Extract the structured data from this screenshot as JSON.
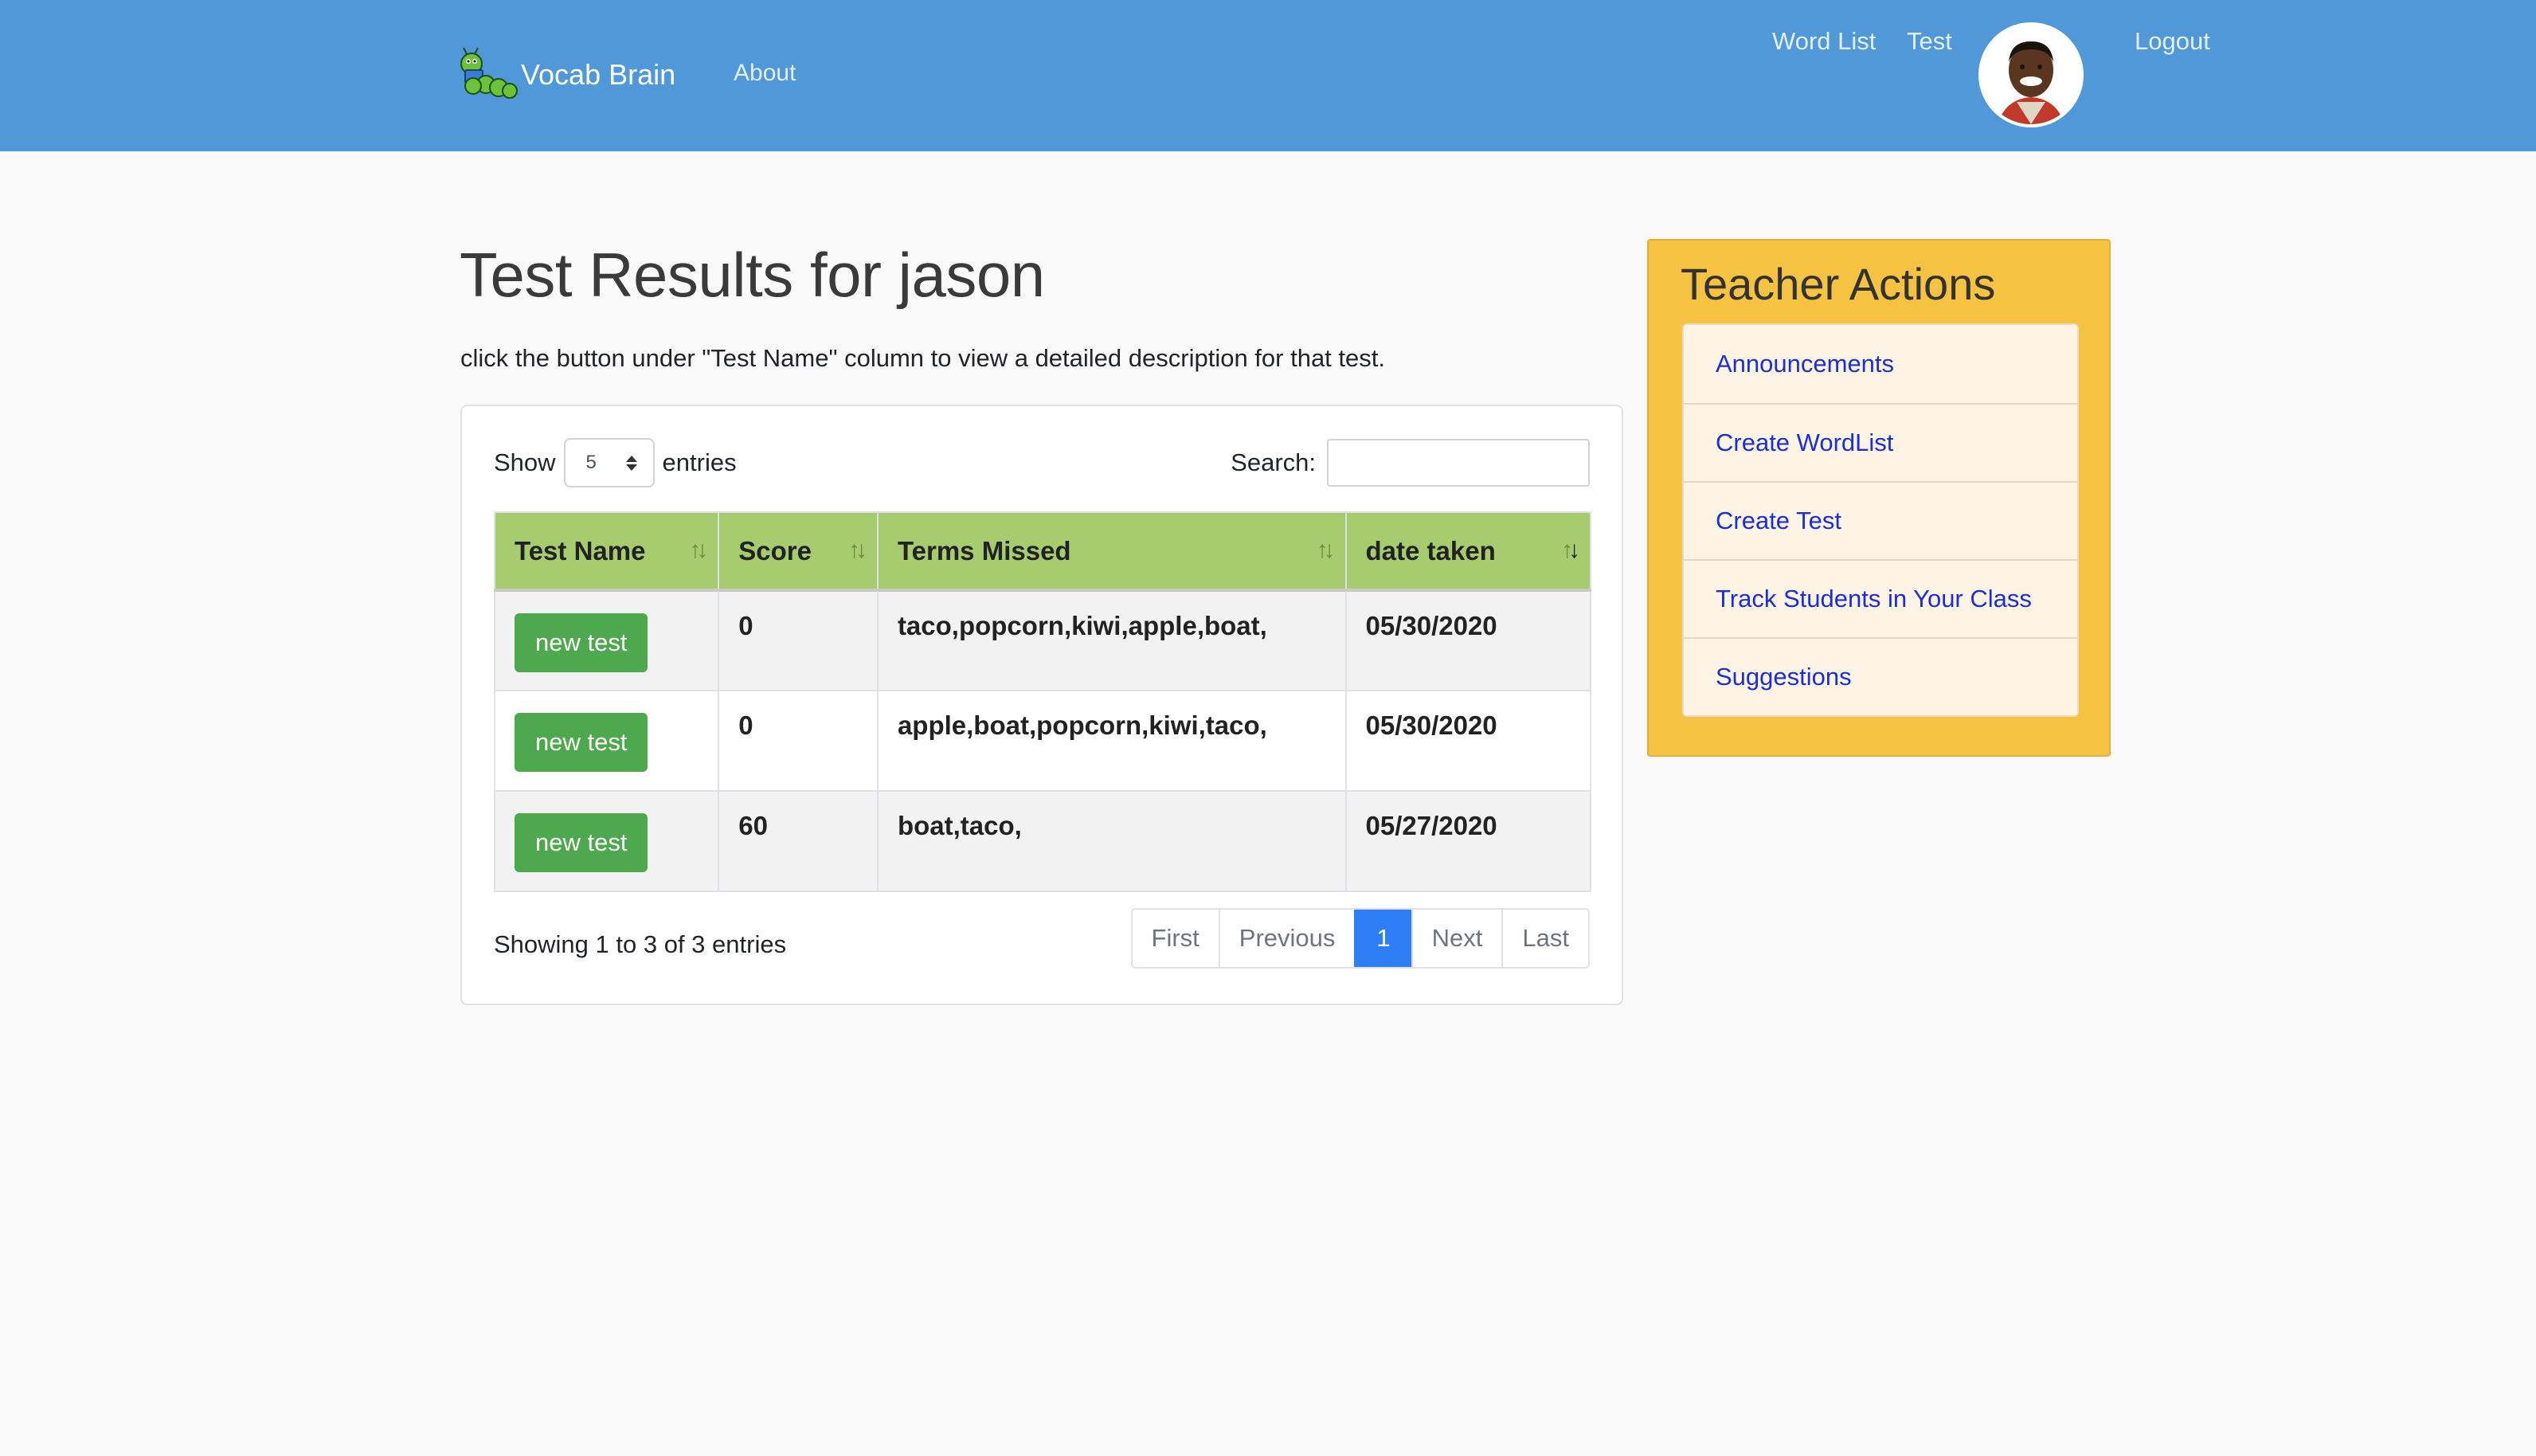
{
  "nav": {
    "brand": "Vocab Brain",
    "about": "About",
    "word_list": "Word List",
    "test": "Test",
    "logout": "Logout"
  },
  "main": {
    "title": "Test Results for jason",
    "instructions": "click the button under \"Test Name\" column to view a detailed description for that test."
  },
  "table_controls": {
    "show_label": "Show",
    "length_value": "5",
    "entries_label": "entries",
    "search_label": "Search:",
    "search_value": ""
  },
  "table": {
    "columns": [
      "Test Name",
      "Score",
      "Terms Missed",
      "date taken"
    ],
    "rows": [
      {
        "test_name": "new test",
        "score": "0",
        "terms_missed": "taco,popcorn,kiwi,apple,boat,",
        "date": "05/30/2020"
      },
      {
        "test_name": "new test",
        "score": "0",
        "terms_missed": "apple,boat,popcorn,kiwi,taco,",
        "date": "05/30/2020"
      },
      {
        "test_name": "new test",
        "score": "60",
        "terms_missed": "boat,taco,",
        "date": "05/27/2020"
      }
    ]
  },
  "footer": {
    "info": "Showing 1 to 3 of 3 entries",
    "pagination": {
      "first": "First",
      "previous": "Previous",
      "current": "1",
      "next": "Next",
      "last": "Last"
    }
  },
  "sidebar": {
    "title": "Teacher Actions",
    "items": [
      {
        "label": "Announcements"
      },
      {
        "label": "Create WordList"
      },
      {
        "label": "Create Test"
      },
      {
        "label": "Track Students in Your Class"
      },
      {
        "label": "Suggestions"
      }
    ]
  },
  "colors": {
    "navbar": "#5098d8",
    "table_header": "#a7cb6f",
    "button_green": "#4ea84e",
    "sidebar_bg": "#f5c242",
    "link_blue": "#1a2fd4",
    "page_active": "#2f7ef5"
  }
}
